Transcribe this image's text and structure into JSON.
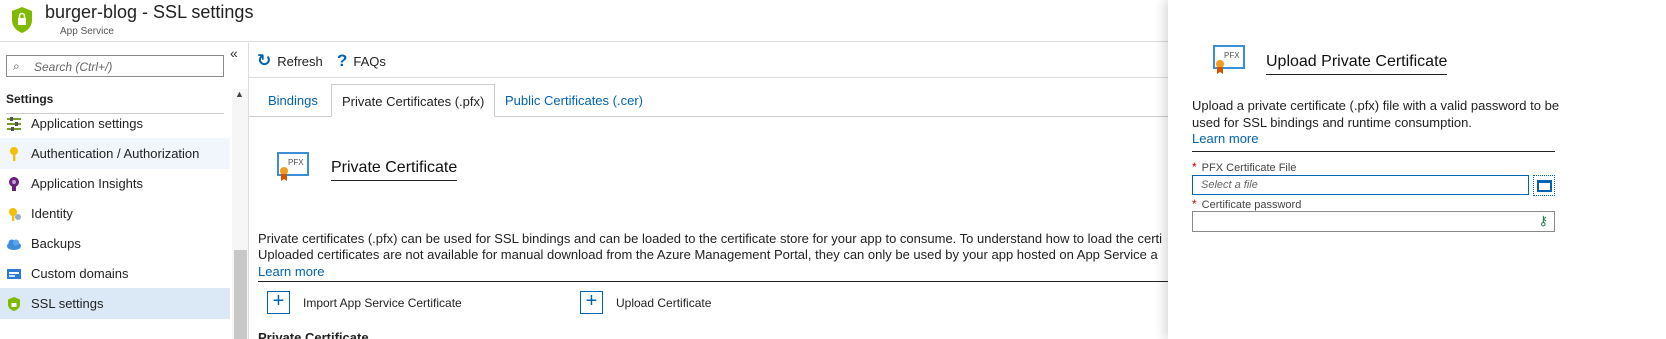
{
  "header": {
    "title": "burger-blog - SSL settings",
    "subtitle": "App Service",
    "logo_icon": "app-service-shield-icon"
  },
  "sidebar": {
    "search_placeholder": "Search (Ctrl+/)",
    "collapse_icon": "double-chevron-left-icon",
    "section_label": "Settings",
    "items": [
      {
        "label": "Application settings",
        "icon": "settings-bars-icon"
      },
      {
        "label": "Authentication / Authorization",
        "icon": "key-icon"
      },
      {
        "label": "Application Insights",
        "icon": "lightbulb-icon"
      },
      {
        "label": "Identity",
        "icon": "identity-key-icon"
      },
      {
        "label": "Backups",
        "icon": "cloud-icon"
      },
      {
        "label": "Custom domains",
        "icon": "domain-icon"
      },
      {
        "label": "SSL settings",
        "icon": "shield-icon"
      }
    ]
  },
  "toolbar": {
    "refresh_label": "Refresh",
    "faq_label": "FAQs"
  },
  "tabs": [
    {
      "label": "Bindings"
    },
    {
      "label": "Private Certificates (.pfx)"
    },
    {
      "label": "Public Certificates (.cer)"
    }
  ],
  "main": {
    "section_title": "Private Certificate",
    "description_line1": "Private certificates (.pfx) can be used for SSL bindings and can be loaded to the certificate store for your app to consume. To understand how to load the certi",
    "description_line2": "Uploaded certificates are not available for manual download from the Azure Management Portal, they can only be used by your app hosted on App Service a",
    "learn_more": "Learn more",
    "import_label": "Import App Service Certificate",
    "upload_label": "Upload Certificate",
    "cut_label": "Private Certificate"
  },
  "panel": {
    "title": "Upload Private Certificate",
    "description": "Upload a private certificate (.pfx) file with a valid password to be used for SSL bindings and runtime consumption.",
    "learn_more": "Learn more",
    "file_label": "PFX Certificate File",
    "file_placeholder": "Select a file",
    "password_label": "Certificate password",
    "required_mark": "*",
    "icon_text": "PFX"
  },
  "colors": {
    "accent": "#0063b1",
    "selected_nav": "#dbe8f6",
    "required": "#cc0000"
  }
}
